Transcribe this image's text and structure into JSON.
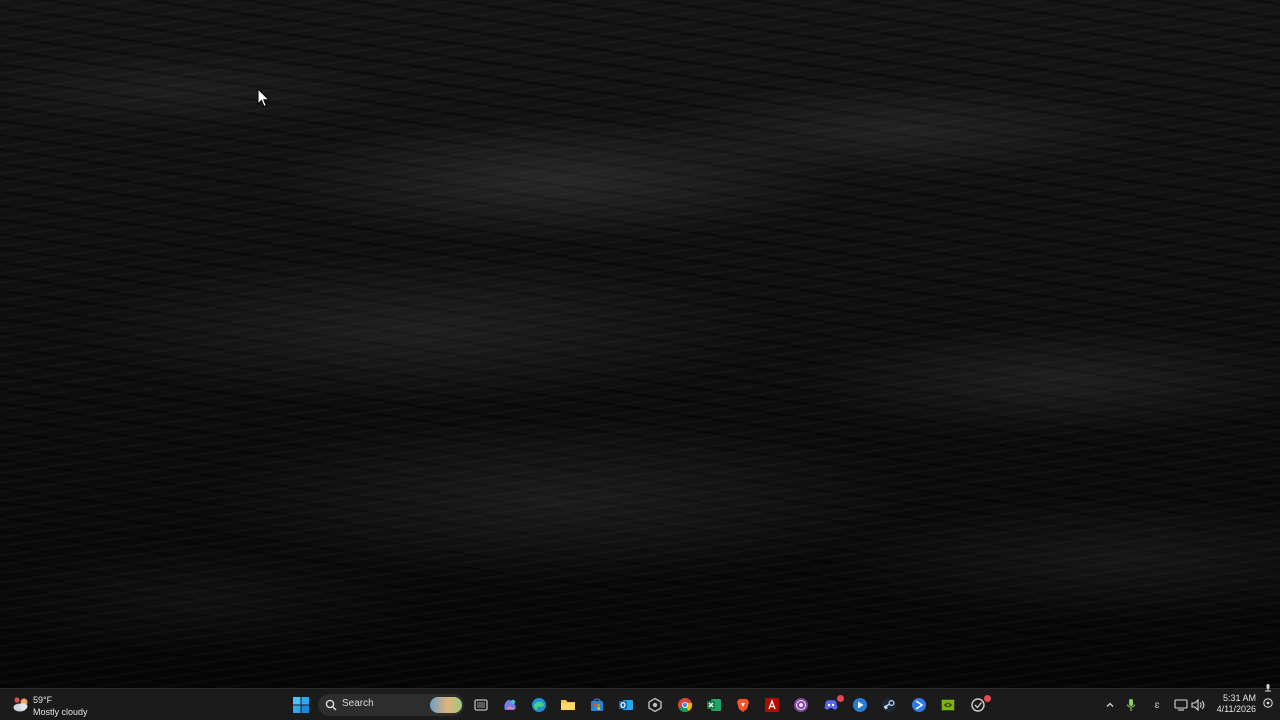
{
  "weather": {
    "temperature": "59°F",
    "condition": "Mostly cloudy"
  },
  "search": {
    "label": "Search"
  },
  "taskbar": {
    "pinned_apps": [
      "start-icon",
      "task-view-icon",
      "copilot-icon",
      "edge-icon",
      "file-explorer-icon",
      "microsoft-store-icon",
      "outlook-icon",
      "settings-icon",
      "chrome-icon",
      "excel-icon",
      "brave-icon",
      "acrobat-icon",
      "tor-browser-icon",
      "discord-icon",
      "media-player-icon",
      "steam-icon",
      "edge-dev-icon",
      "nvidia-icon",
      "app-icon"
    ],
    "discord_badge": "99+"
  },
  "tray": {
    "keyboard_indicator": "ɛ"
  },
  "clock": {
    "time": "5:31 AM",
    "date": "4/11/2026"
  },
  "colors": {
    "taskbar_bg": "#1b1b1b",
    "accent_blue": "#3a96dd",
    "badge_red": "#e5484d"
  }
}
